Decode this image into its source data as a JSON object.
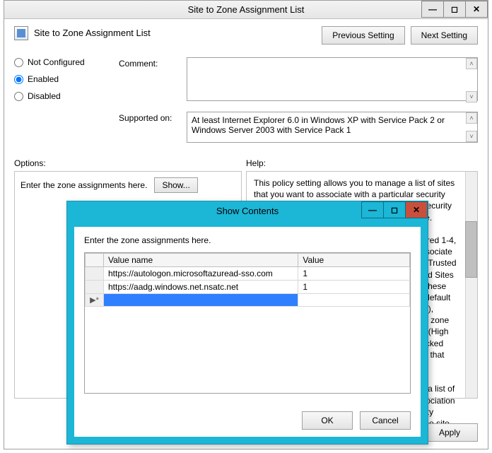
{
  "window": {
    "title": "Site to Zone Assignment List",
    "header_title": "Site to Zone Assignment List",
    "prev_label": "Previous Setting",
    "next_label": "Next Setting",
    "radio": {
      "not_configured": "Not Configured",
      "enabled": "Enabled",
      "disabled": "Disabled"
    },
    "comment_label": "Comment:",
    "comment_value": "",
    "supported_label": "Supported on:",
    "supported_text": "At least Internet Explorer 6.0 in Windows XP with Service Pack 2 or Windows Server 2003 with Service Pack 1",
    "options_label": "Options:",
    "help_label": "Help:",
    "options_prompt": "Enter the zone assignments here.",
    "show_label": "Show...",
    "help_text": "This policy setting allows you to manage a list of sites that you want to associate with a particular security zone. These zone numbers have associated security settings that apply to all of the sites in the zone.\n\nInternet Explorer has 4 security zones, numbered 1-4, and these are used by this policy setting to associate sites to zones. They are: (1) Intranet zone, (2) Trusted Sites zone, (3) Internet zone, and (4) Restricted Sites zone. Security settings can be set for each of these zones through other policy settings, and their default settings are: Trusted Sites zone (Low template), Intranet zone (Medium-Low template), Internet zone (Medium template), and Restricted Sites zone (High template). (The Local Machine zone and its locked down equivalent have special security settings that protect your local computer.)\n\nIf you enable this policy setting, you can enter a list of sites and their related zone numbers. The association of a site with a zone will ensure that the security settings for the specified zone are applied to the site. For each entry that you add to the list, enter",
    "ok_label": "OK",
    "cancel_label": "Cancel",
    "apply_label": "Apply"
  },
  "modal": {
    "title": "Show Contents",
    "prompt": "Enter the zone assignments here.",
    "col_name": "Value name",
    "col_value": "Value",
    "rows": [
      {
        "name": "https://autologon.microsoftazuread-sso.com",
        "value": "1"
      },
      {
        "name": "https://aadg.windows.net.nsatc.net",
        "value": "1"
      }
    ],
    "ok_label": "OK",
    "cancel_label": "Cancel",
    "newrow_marker": "▶*"
  }
}
